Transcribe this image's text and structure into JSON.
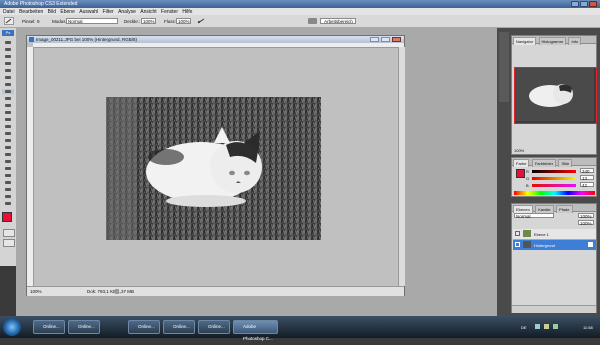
{
  "window": {
    "title": "Adobe Photoshop CS3 Extended"
  },
  "menu": [
    "Datei",
    "Bearbeiten",
    "Bild",
    "Ebene",
    "Auswahl",
    "Filter",
    "Analyse",
    "Ansicht",
    "Fenster",
    "Hilfe"
  ],
  "options": {
    "pinsel_label": "Pinsel:",
    "pinsel_value": "9",
    "modus_label": "Modus:",
    "modus_value": "Normal",
    "deckkraft_label": "Deckkr.:",
    "deckkraft_value": "100%",
    "fluss_label": "Fluss:",
    "fluss_value": "100%",
    "workspace_button": "Arbeitsbereich"
  },
  "document": {
    "title": "Image_00211.JPG bei 100% (Hintergrund, RGB/8)",
    "zoom": "100%",
    "info": "Dok: 793,1 KB/1,37 MB"
  },
  "navigator": {
    "tabs": [
      "Navigator",
      "Histogramm",
      "Info"
    ],
    "zoom": "100%"
  },
  "color_panel": {
    "tabs": [
      "Farbe",
      "Farbfelder",
      "Stile"
    ],
    "channels": [
      {
        "label": "R",
        "value": "240"
      },
      {
        "label": "G",
        "value": "13"
      },
      {
        "label": "B",
        "value": "42"
      }
    ],
    "foreground": "#e8103a"
  },
  "layers_panel": {
    "tabs": [
      "Ebenen",
      "Kanäle",
      "Pfade"
    ],
    "mode": "Normal",
    "opacity": "100%",
    "fill": "100%",
    "layers": [
      {
        "name": "Ebene 1"
      },
      {
        "name": "Hintergrund"
      }
    ]
  },
  "taskbar": {
    "tasks": [
      "Online...",
      "Online...",
      "Online...",
      "Online...",
      "Online...",
      "Adobe Photoshop C..."
    ],
    "clock": "11:58",
    "lang": "DE"
  }
}
